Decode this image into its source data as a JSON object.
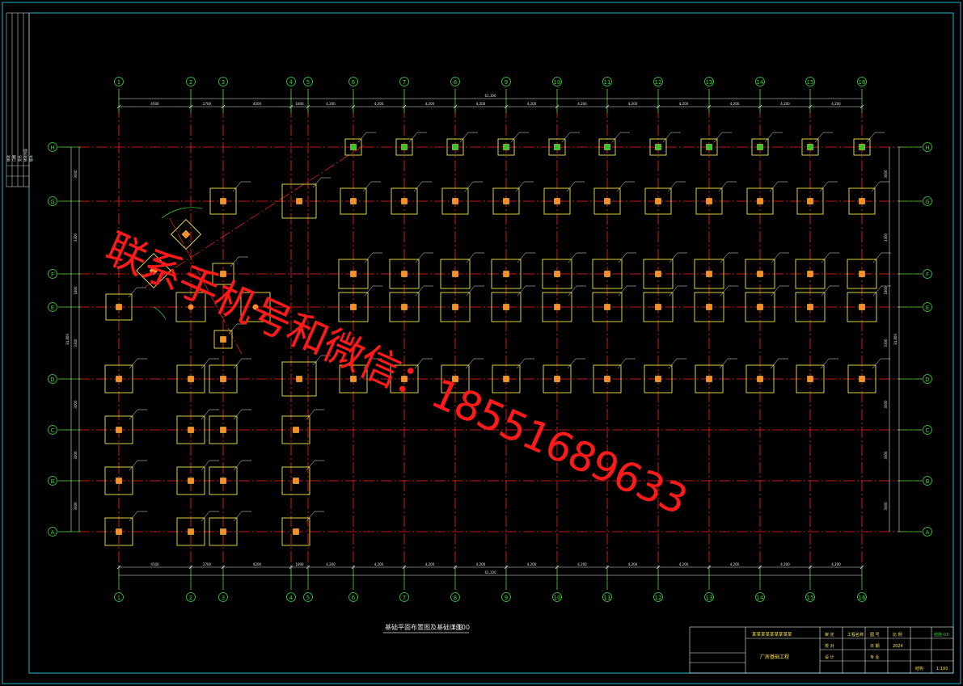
{
  "drawing": {
    "title": "基础平面布置图及基础详图",
    "scale": "1:100",
    "columns": [
      "1",
      "2",
      "3",
      "4",
      "5",
      "6",
      "7",
      "8",
      "9",
      "10",
      "11",
      "12",
      "13",
      "14",
      "15",
      "16"
    ],
    "rows": [
      "H",
      "G",
      "F",
      "E",
      "D",
      "C",
      "B",
      "A"
    ],
    "span_labels_bottom": [
      "4500",
      "2700",
      "4200",
      "1800",
      "4,200",
      "4,200",
      "4,200",
      "4,200",
      "4,200",
      "4,200",
      "4,200",
      "4,200",
      "4,200",
      "4,200",
      "4,200"
    ],
    "span_labels_top": [
      "4500",
      "2700",
      "4200",
      "1800",
      "4,200",
      "4,200",
      "4,200",
      "4,200",
      "4,200",
      "4,200",
      "4,200",
      "4,200",
      "4,200",
      "4,200",
      "4,200"
    ],
    "total_label": "61,100",
    "row_span_labels": [
      "3000",
      "3300",
      "1800",
      "3300",
      "3000",
      "3000",
      "3000"
    ],
    "row_total_label": "34,800"
  },
  "title_block": {
    "design_unit": "某某某某某某某某某",
    "project": "厂房基础工程",
    "cells": [
      "审 定",
      "校 对",
      "设 计",
      "工程名称",
      "图 号",
      "日 期",
      "专 业",
      "比 例",
      "结施-03",
      "结构",
      "1:100",
      "2024"
    ]
  },
  "revision_strip": [
    "修改",
    "日期",
    "签名",
    "修改内容",
    "版本"
  ],
  "watermark": "联系手机号和微信：18551689633"
}
